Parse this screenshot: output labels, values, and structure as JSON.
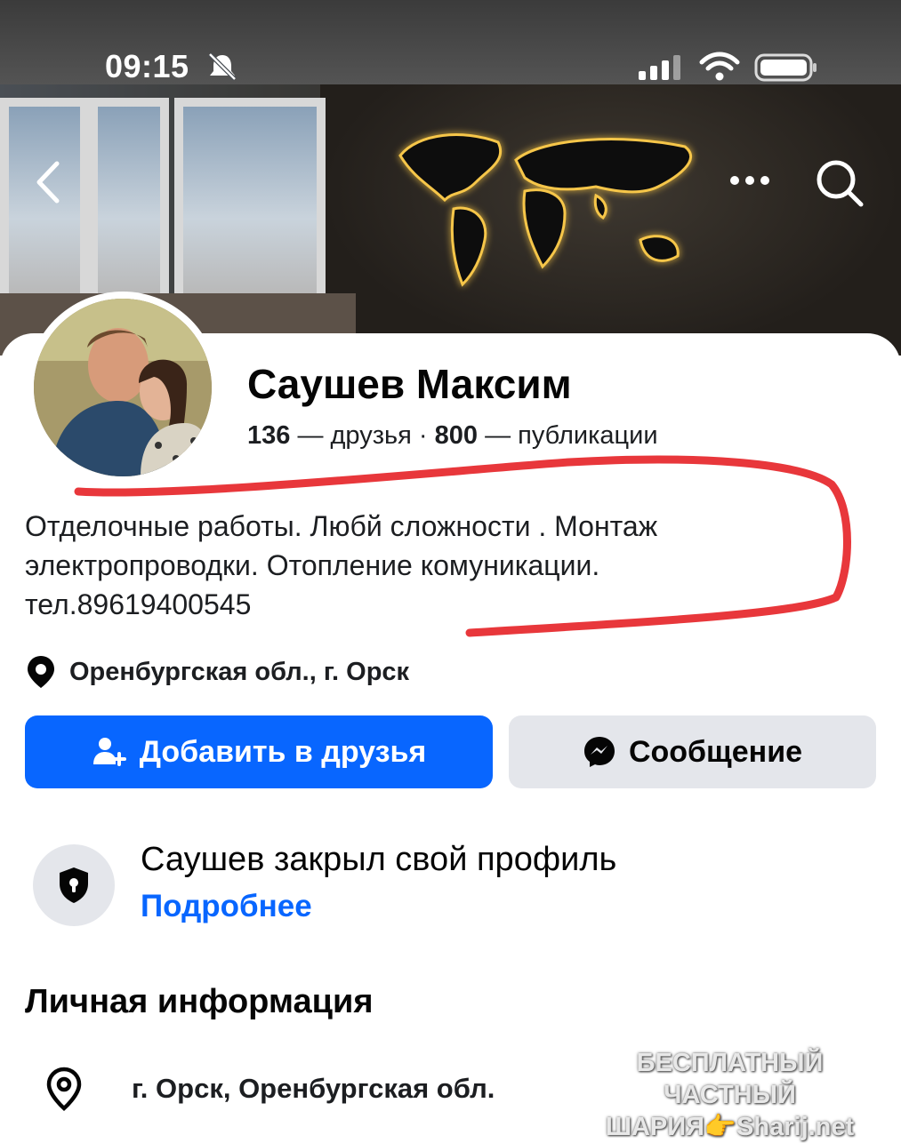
{
  "status_bar": {
    "time": "09:15"
  },
  "header": {
    "back_icon": "chevron-left-icon",
    "more_icon": "ellipsis-icon",
    "search_icon": "search-icon"
  },
  "profile": {
    "name": "Саушев Максим",
    "friends_count": "136",
    "friends_label": "— друзья",
    "separator": "·",
    "posts_count": "800",
    "posts_label": "— публикации",
    "bio_lines": [
      "Отделочные работы. Любй сложности . Монтаж",
      "электропроводки. Отопление комуникации.",
      "тел.89619400545"
    ],
    "location": "Оренбургская обл., г. Орск"
  },
  "actions": {
    "add_friend_label": "Добавить в друзья",
    "message_label": "Сообщение"
  },
  "privacy": {
    "title": "Саушев закрыл свой профиль",
    "link_label": "Подробнее"
  },
  "personal_info": {
    "title": "Личная информация",
    "city": "г. Орск, Оренбургская обл."
  },
  "watermark": {
    "line1": "БЕСПЛАТНЫЙ ЧАСТНЫЙ",
    "line2": "ШАРИЯ👉Sharij.net"
  },
  "colors": {
    "accent": "#0866ff",
    "annotation": "#e8373b",
    "button_gray": "#e4e6eb"
  }
}
